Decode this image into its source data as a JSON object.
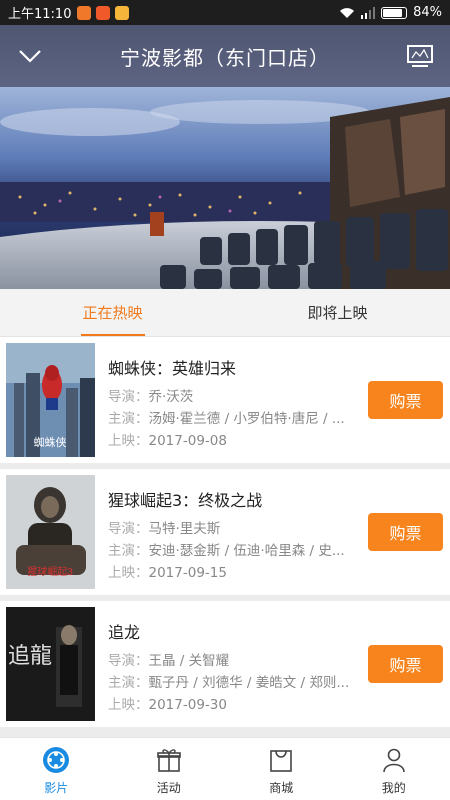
{
  "status_bar": {
    "time": "上午11:10",
    "battery": "84%",
    "battery_level": 0.84
  },
  "header": {
    "title": "宁波影都（东门口店）"
  },
  "tabs": [
    {
      "label": "正在热映",
      "active": true
    },
    {
      "label": "即将上映",
      "active": false
    }
  ],
  "labels": {
    "director": "导演：",
    "cast": "主演：",
    "release": "上映：",
    "buy": "购票"
  },
  "movies": [
    {
      "title": "蜘蛛侠：英雄归来",
      "director": "乔·沃茨",
      "cast": "汤姆·霍兰德 / 小罗伯特·唐尼 / ...",
      "release": "2017-09-08",
      "poster_text": "蜘蛛侠"
    },
    {
      "title": "猩球崛起3：终极之战",
      "director": "马特·里夫斯",
      "cast": "安迪·瑟金斯 / 伍迪·哈里森 / 史...",
      "release": "2017-09-15",
      "poster_text": "猩球崛起3"
    },
    {
      "title": "追龙",
      "director": "王晶 / 关智耀",
      "cast": "甄子丹 / 刘德华 / 姜皓文 / 郑则...",
      "release": "2017-09-30",
      "poster_text": "追龍"
    }
  ],
  "bottom_nav": [
    {
      "label": "影片",
      "icon": "film-reel-icon",
      "active": true
    },
    {
      "label": "活动",
      "icon": "gift-icon",
      "active": false
    },
    {
      "label": "商城",
      "icon": "shopping-bag-icon",
      "active": false
    },
    {
      "label": "我的",
      "icon": "user-icon",
      "active": false
    }
  ],
  "colors": {
    "accent": "#f7841d",
    "tab_active": "#f07a1c",
    "nav_active": "#1a8be0",
    "header_bg": "#575e7b"
  }
}
